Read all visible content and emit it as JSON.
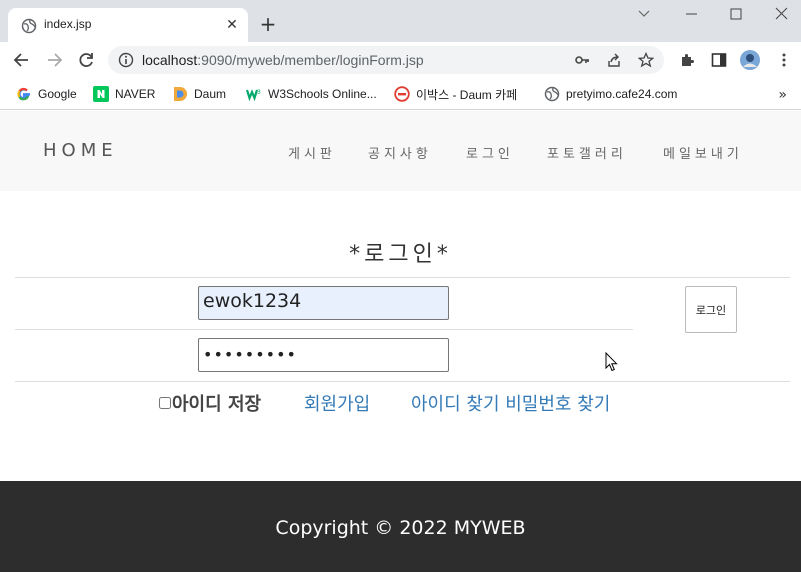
{
  "browser": {
    "tab_title": "index.jsp",
    "url_host": "localhost",
    "url_rest": ":9090/myweb/member/loginForm.jsp",
    "bookmarks": [
      {
        "label": "Google",
        "icon": "google-icon",
        "color": "#4285f4"
      },
      {
        "label": "NAVER",
        "icon": "naver-icon",
        "color": "#03c75a"
      },
      {
        "label": "Daum",
        "icon": "daum-icon",
        "color": "#f2a93b"
      },
      {
        "label": "W3Schools Online...",
        "icon": "w3schools-icon",
        "color": "#04aa6d"
      },
      {
        "label": "이박스 - Daum 카페",
        "icon": "daum-cafe-icon",
        "color": "#e03c31"
      },
      {
        "label": "pretyimo.cafe24.com",
        "icon": "globe-icon",
        "color": "#5f6368"
      }
    ]
  },
  "site": {
    "brand": "HOME",
    "menu": [
      "게시판",
      "공지사항",
      "로그인",
      "포토갤러리",
      "메일보내기"
    ]
  },
  "login": {
    "title": "*로그인*",
    "id_value": "ewok1234",
    "pw_mask": "•••••••••",
    "button_label": "로그인",
    "save_label": "아이디 저장",
    "signup_link": "회원가입",
    "find_link": "아이디 찾기 비밀번호 찾기"
  },
  "footer": {
    "copyright": "Copyright © 2022 MYWEB"
  },
  "colors": {
    "link": "#337ab7",
    "footer_bg": "#2d2d2d",
    "header_bg": "#f8f8f8",
    "autofill_bg": "#e8f0fe"
  }
}
